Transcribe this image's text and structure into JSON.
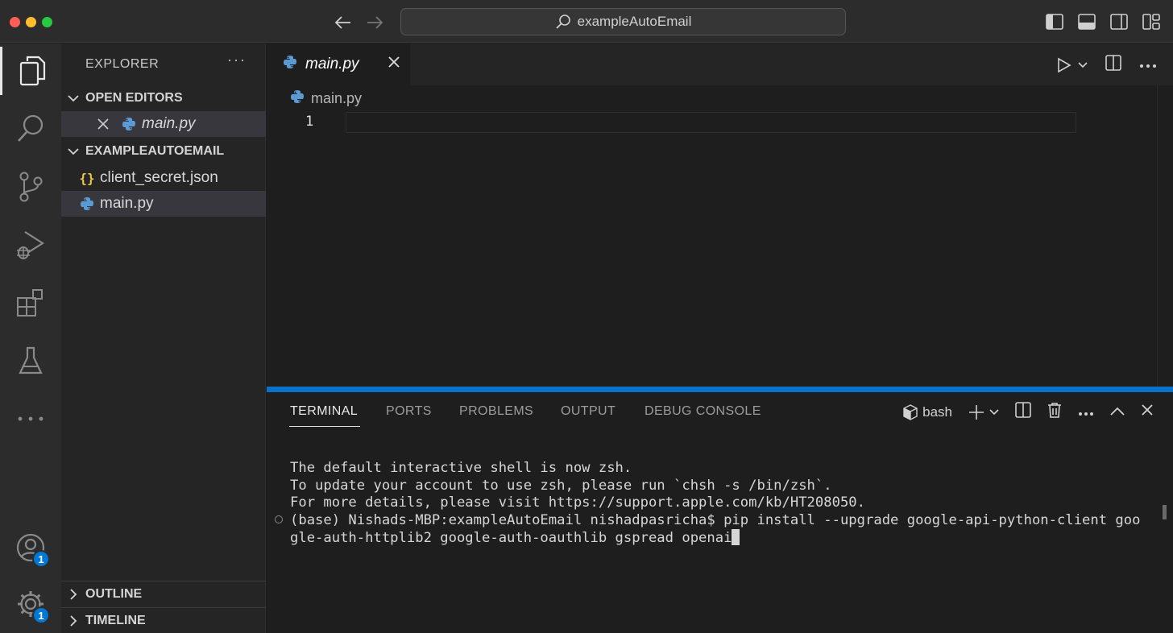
{
  "window": {
    "search_text": "exampleAutoEmail"
  },
  "activity_bar": {
    "accounts_badge": "1",
    "settings_badge": "1"
  },
  "sidebar": {
    "title": "EXPLORER",
    "open_editors": {
      "header": "OPEN EDITORS",
      "items": [
        {
          "label": "main.py"
        }
      ]
    },
    "folder": {
      "header": "EXAMPLEAUTOEMAIL",
      "items": [
        {
          "label": "client_secret.json",
          "icon": "json-braces-icon"
        },
        {
          "label": "main.py",
          "icon": "python-icon"
        }
      ]
    },
    "outline_header": "OUTLINE",
    "timeline_header": "TIMELINE"
  },
  "editor": {
    "tab_label": "main.py",
    "breadcrumb": "main.py",
    "line_number": "1"
  },
  "panel": {
    "tabs": [
      "TERMINAL",
      "PORTS",
      "PROBLEMS",
      "OUTPUT",
      "DEBUG CONSOLE"
    ],
    "shell_label": "bash",
    "terminal_lines": [
      "The default interactive shell is now zsh.",
      "To update your account to use zsh, please run `chsh -s /bin/zsh`.",
      "For more details, please visit https://support.apple.com/kb/HT208050.",
      "(base) Nishads-MBP:exampleAutoEmail nishadpasricha$ pip install --upgrade google-api-python-client goo",
      "gle-auth-httplib2 google-auth-oauthlib gspread openai"
    ]
  },
  "colors": {
    "accent": "#0a72c8",
    "badge": "#0078d4",
    "json_icon": "#e8c94a",
    "python_icon": "#5b9bd5"
  }
}
